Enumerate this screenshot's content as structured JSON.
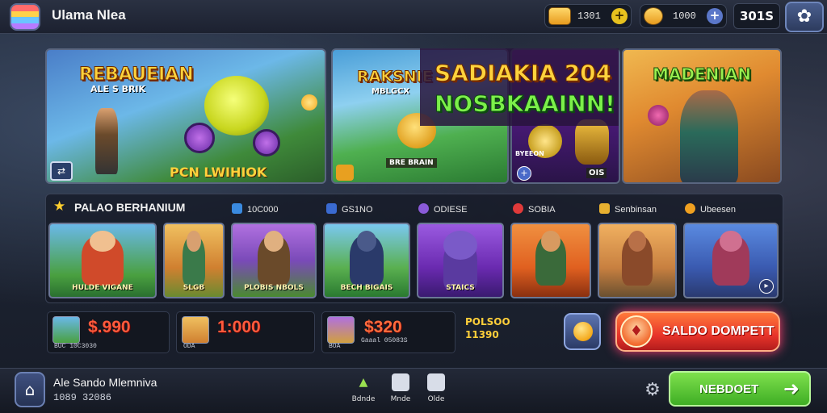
{
  "header": {
    "title": "Ulama Nlea",
    "currency1_value": "1301",
    "currency2_value": "1000",
    "add_symbol": "+",
    "level_value": "301S"
  },
  "banners": [
    {
      "title": "REBAUEIAN",
      "subtitle": "ALE S BRIK",
      "footer": "PCN LWIHIOK"
    },
    {
      "title": "RAKSNIE",
      "subtitle": "MBLGCX",
      "footer": "BRE BRAIN"
    },
    {
      "title": "SADIAKIA 204",
      "subtitle": "NOSBKAAINN!",
      "footer": "BYEEON",
      "badge": "OIS"
    },
    {
      "title": "MADENIAN"
    }
  ],
  "section": {
    "title": "PALAO BERHANIUM",
    "tabs": [
      "10C000",
      "GS1NO",
      "ODIESE",
      "SOBIA",
      "Senbinsan",
      "Ubeesen"
    ]
  },
  "game_cards": [
    {
      "label": "HULDE VIGANE"
    },
    {
      "label": "SLGB"
    },
    {
      "label": "PLOBIS NBOLS"
    },
    {
      "label": "BECH BIGAIS"
    },
    {
      "label": "STAICS"
    },
    {
      "label": ""
    },
    {
      "label": ""
    },
    {
      "label": ""
    }
  ],
  "rewards": [
    {
      "amount": "$.990",
      "sub": "BUC 10C3030"
    },
    {
      "amount": "1:000",
      "sub": "ODA"
    },
    {
      "amount": "$320",
      "sub": "Gaaal 05083S",
      "sub2": "BOA"
    }
  ],
  "promo": {
    "title": "POLSOO",
    "number": "11390"
  },
  "saldo_button": {
    "label": "SALDO DOMPETT"
  },
  "footer": {
    "player_name": "Ale Sando Mlemniva",
    "player_id": "1089 32086",
    "nav": [
      "Bdnde",
      "Mnde",
      "Olde"
    ],
    "play_label": "NEBDOET"
  },
  "colors": {
    "accent_orange": "#e8342a",
    "accent_green": "#3fae25",
    "gold": "#ffd23c"
  }
}
